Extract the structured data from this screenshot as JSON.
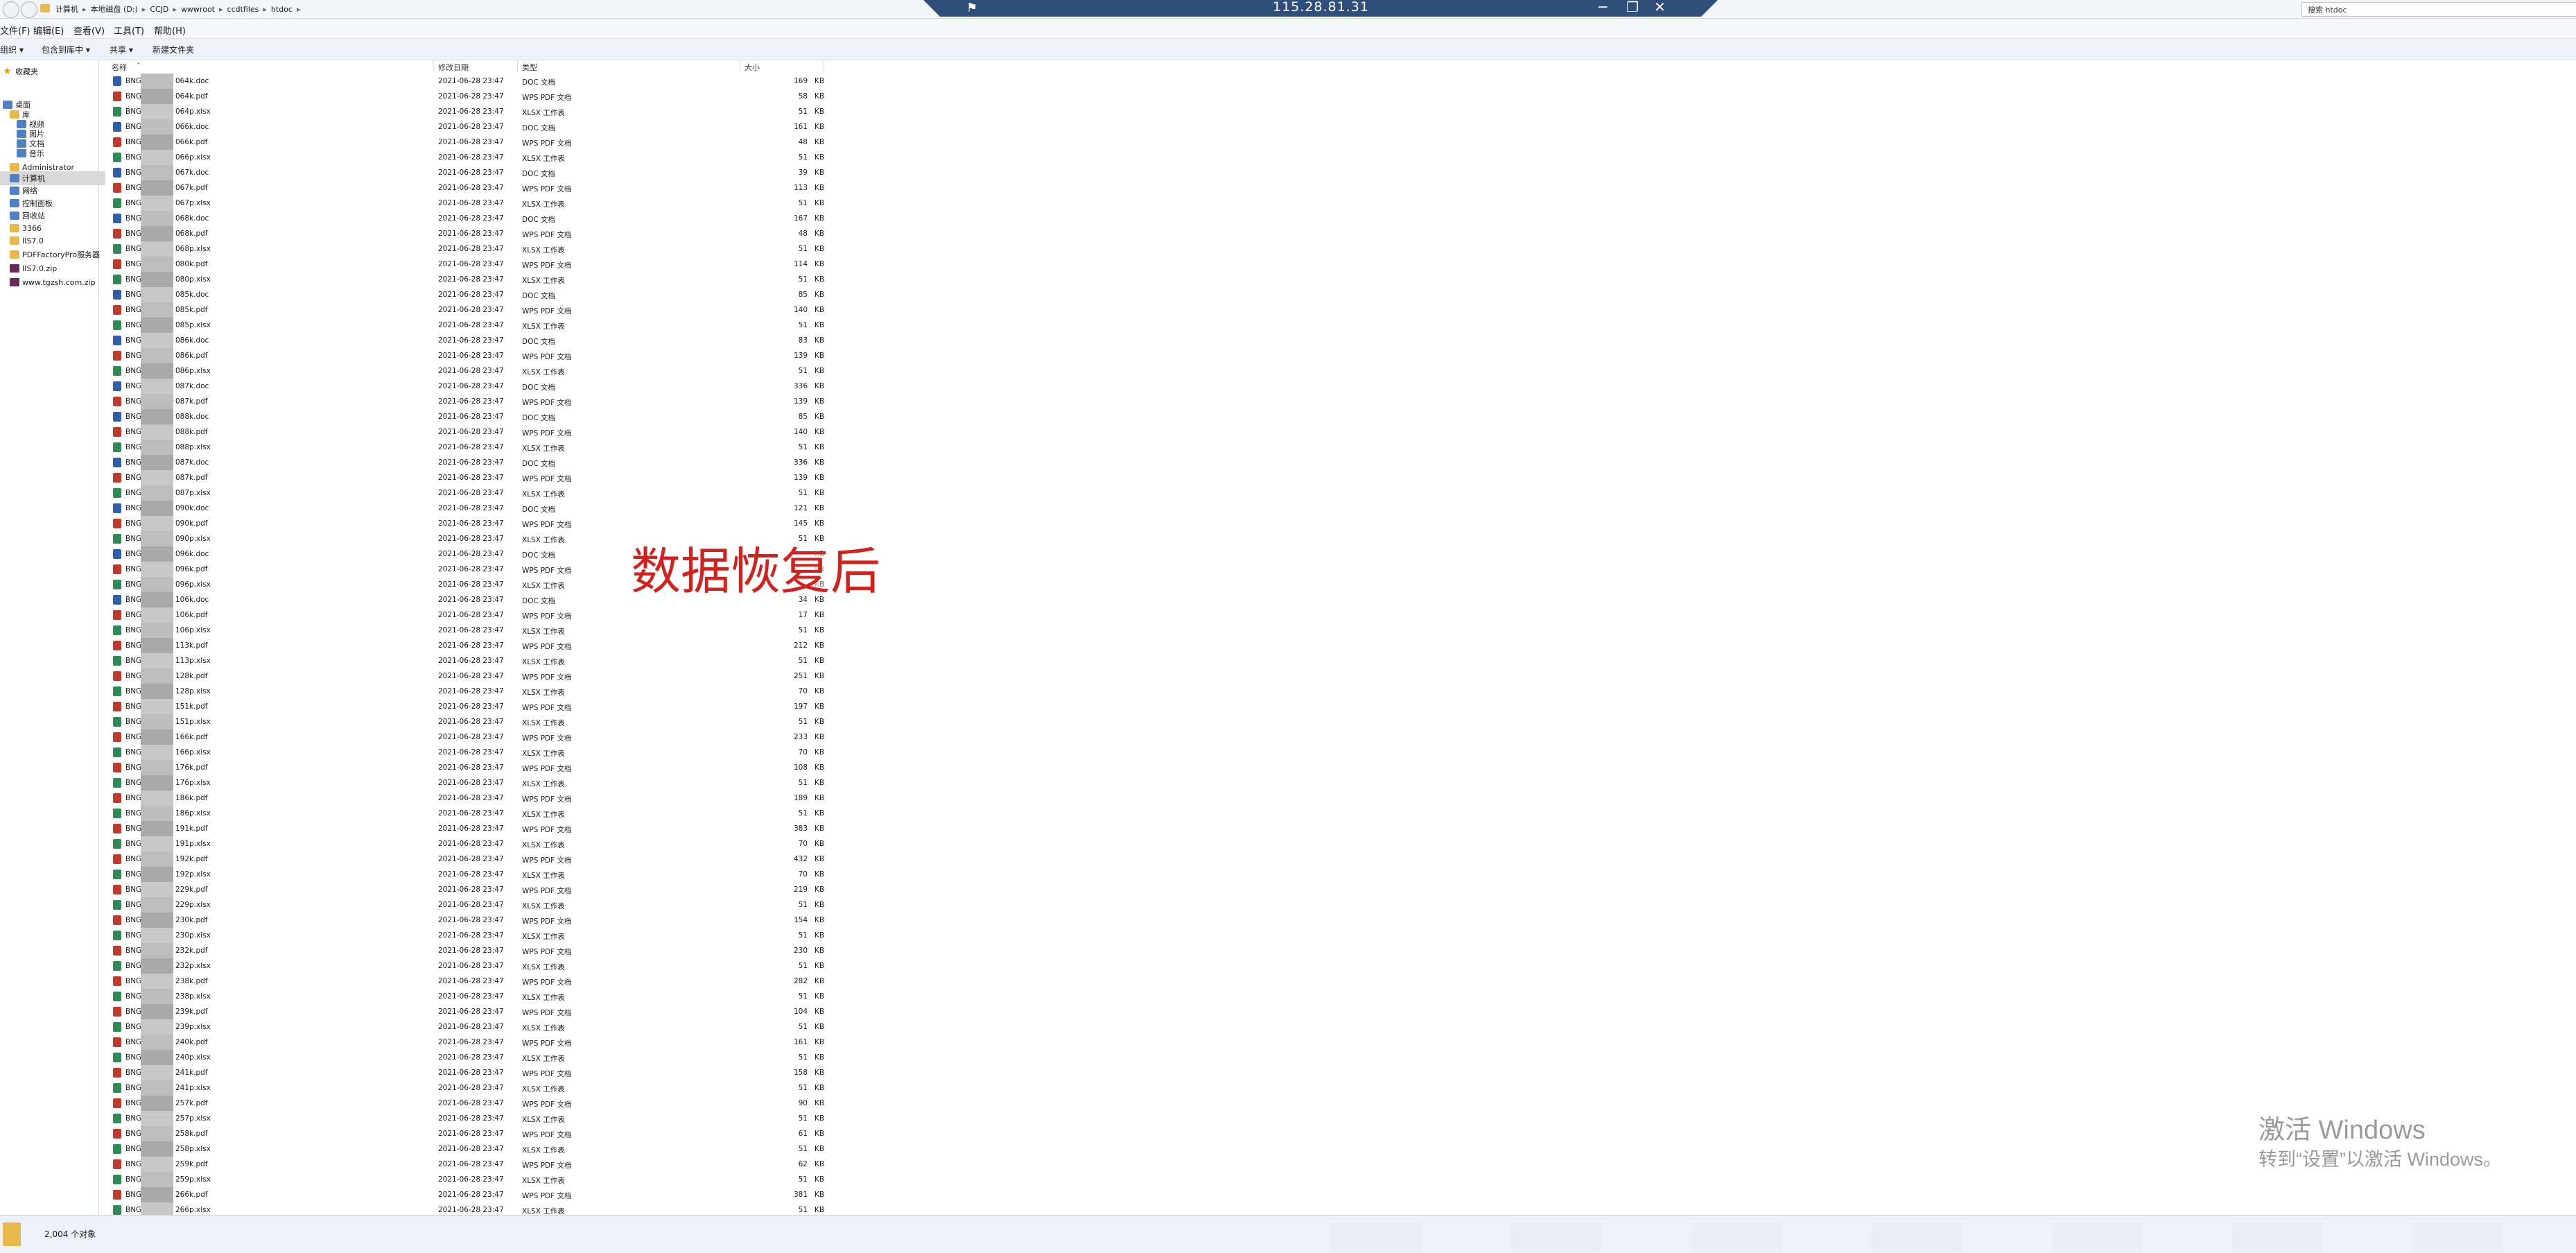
{
  "window": {
    "breadcrumb": [
      "计算机",
      "本地磁盘 (D:)",
      "CCJD",
      "wwwroot",
      "ccdtfiles",
      "htdoc"
    ],
    "remote_title": "115.28.81.31",
    "search_placeholder": "搜索 htdoc"
  },
  "menu": {
    "items": [
      "文件(F)",
      "编辑(E)",
      "查看(V)",
      "工具(T)",
      "帮助(H)"
    ]
  },
  "toolbar": {
    "items": [
      "组织 ▾",
      "包含到库中 ▾",
      "共享 ▾",
      "新建文件夹"
    ]
  },
  "nav": {
    "items": [
      {
        "label": "收藏夹",
        "icon": "star-icon",
        "level": 0
      },
      {
        "label": "桌面",
        "icon": "desktop-icon",
        "level": 0
      },
      {
        "label": "库",
        "icon": "library-icon",
        "level": 1
      },
      {
        "label": "视频",
        "icon": "video-icon",
        "level": 2
      },
      {
        "label": "图片",
        "icon": "picture-icon",
        "level": 2
      },
      {
        "label": "文档",
        "icon": "document-icon",
        "level": 2
      },
      {
        "label": "音乐",
        "icon": "music-icon",
        "level": 2
      },
      {
        "label": "Administrator",
        "icon": "user-folder-icon",
        "level": 1
      },
      {
        "label": "计算机",
        "icon": "computer-icon",
        "level": 1,
        "selected": true
      },
      {
        "label": "网络",
        "icon": "network-icon",
        "level": 1
      },
      {
        "label": "控制面板",
        "icon": "control-panel-icon",
        "level": 1
      },
      {
        "label": "回收站",
        "icon": "recycle-bin-icon",
        "level": 1
      },
      {
        "label": "3366",
        "icon": "folder-icon",
        "level": 1
      },
      {
        "label": "IIS7.0",
        "icon": "folder-icon",
        "level": 1
      },
      {
        "label": "PDFFactoryPro服务器",
        "icon": "folder-icon",
        "level": 1
      },
      {
        "label": "IIS7.0.zip",
        "icon": "zip-icon",
        "level": 1
      },
      {
        "label": "www.tgzsh.com.zip",
        "icon": "zip-icon",
        "level": 1
      }
    ]
  },
  "columns": [
    "名称",
    "修改日期",
    "类型",
    "大小"
  ],
  "file_prefix": "BNG",
  "date": "2021-06-28 23:47",
  "size_unit": "KB",
  "files": [
    {
      "n": "064k.doc",
      "t": "DOC 文档",
      "s": "169",
      "i": "doc"
    },
    {
      "n": "064k.pdf",
      "t": "WPS PDF 文档",
      "s": "58",
      "i": "pdf"
    },
    {
      "n": "064p.xlsx",
      "t": "XLSX 工作表",
      "s": "51",
      "i": "xls"
    },
    {
      "n": "066k.doc",
      "t": "DOC 文档",
      "s": "161",
      "i": "doc"
    },
    {
      "n": "066k.pdf",
      "t": "WPS PDF 文档",
      "s": "48",
      "i": "pdf"
    },
    {
      "n": "066p.xlsx",
      "t": "XLSX 工作表",
      "s": "51",
      "i": "xls"
    },
    {
      "n": "067k.doc",
      "t": "DOC 文档",
      "s": "39",
      "i": "doc"
    },
    {
      "n": "067k.pdf",
      "t": "WPS PDF 文档",
      "s": "113",
      "i": "pdf"
    },
    {
      "n": "067p.xlsx",
      "t": "XLSX 工作表",
      "s": "51",
      "i": "xls"
    },
    {
      "n": "068k.doc",
      "t": "DOC 文档",
      "s": "167",
      "i": "doc"
    },
    {
      "n": "068k.pdf",
      "t": "WPS PDF 文档",
      "s": "48",
      "i": "pdf"
    },
    {
      "n": "068p.xlsx",
      "t": "XLSX 工作表",
      "s": "51",
      "i": "xls"
    },
    {
      "n": "080k.pdf",
      "t": "WPS PDF 文档",
      "s": "114",
      "i": "pdf"
    },
    {
      "n": "080p.xlsx",
      "t": "XLSX 工作表",
      "s": "51",
      "i": "xls"
    },
    {
      "n": "085k.doc",
      "t": "DOC 文档",
      "s": "85",
      "i": "doc"
    },
    {
      "n": "085k.pdf",
      "t": "WPS PDF 文档",
      "s": "140",
      "i": "pdf"
    },
    {
      "n": "085p.xlsx",
      "t": "XLSX 工作表",
      "s": "51",
      "i": "xls"
    },
    {
      "n": "086k.doc",
      "t": "DOC 文档",
      "s": "83",
      "i": "doc"
    },
    {
      "n": "086k.pdf",
      "t": "WPS PDF 文档",
      "s": "139",
      "i": "pdf"
    },
    {
      "n": "086p.xlsx",
      "t": "XLSX 工作表",
      "s": "51",
      "i": "xls"
    },
    {
      "n": "087k.doc",
      "t": "DOC 文档",
      "s": "336",
      "i": "doc"
    },
    {
      "n": "087k.pdf",
      "t": "WPS PDF 文档",
      "s": "139",
      "i": "pdf"
    },
    {
      "n": "088k.doc",
      "t": "DOC 文档",
      "s": "85",
      "i": "doc"
    },
    {
      "n": "088k.pdf",
      "t": "WPS PDF 文档",
      "s": "140",
      "i": "pdf"
    },
    {
      "n": "088p.xlsx",
      "t": "XLSX 工作表",
      "s": "51",
      "i": "xls"
    },
    {
      "n": "087k.doc",
      "t": "DOC 文档",
      "s": "336",
      "i": "doc"
    },
    {
      "n": "087k.pdf",
      "t": "WPS PDF 文档",
      "s": "139",
      "i": "pdf"
    },
    {
      "n": "087p.xlsx",
      "t": "XLSX 工作表",
      "s": "51",
      "i": "xls"
    },
    {
      "n": "090k.doc",
      "t": "DOC 文档",
      "s": "121",
      "i": "doc"
    },
    {
      "n": "090k.pdf",
      "t": "WPS PDF 文档",
      "s": "145",
      "i": "pdf"
    },
    {
      "n": "090p.xlsx",
      "t": "XLSX 工作表",
      "s": "51",
      "i": "xls"
    },
    {
      "n": "096k.doc",
      "t": "DOC 文档",
      "s": "",
      "i": "doc"
    },
    {
      "n": "096k.pdf",
      "t": "WPS PDF 文档",
      "s": "",
      "i": "pdf"
    },
    {
      "n": "096p.xlsx",
      "t": "XLSX 工作表",
      "s": "",
      "i": "xls"
    },
    {
      "n": "106k.doc",
      "t": "DOC 文档",
      "s": "34",
      "i": "doc"
    },
    {
      "n": "106k.pdf",
      "t": "WPS PDF 文档",
      "s": "17",
      "i": "pdf"
    },
    {
      "n": "106p.xlsx",
      "t": "XLSX 工作表",
      "s": "51",
      "i": "xls"
    },
    {
      "n": "113k.pdf",
      "t": "WPS PDF 文档",
      "s": "212",
      "i": "pdf"
    },
    {
      "n": "113p.xlsx",
      "t": "XLSX 工作表",
      "s": "51",
      "i": "xls"
    },
    {
      "n": "128k.pdf",
      "t": "WPS PDF 文档",
      "s": "251",
      "i": "pdf"
    },
    {
      "n": "128p.xlsx",
      "t": "XLSX 工作表",
      "s": "70",
      "i": "xls"
    },
    {
      "n": "151k.pdf",
      "t": "WPS PDF 文档",
      "s": "197",
      "i": "pdf"
    },
    {
      "n": "151p.xlsx",
      "t": "XLSX 工作表",
      "s": "51",
      "i": "xls"
    },
    {
      "n": "166k.pdf",
      "t": "WPS PDF 文档",
      "s": "233",
      "i": "pdf"
    },
    {
      "n": "166p.xlsx",
      "t": "XLSX 工作表",
      "s": "70",
      "i": "xls"
    },
    {
      "n": "176k.pdf",
      "t": "WPS PDF 文档",
      "s": "108",
      "i": "pdf"
    },
    {
      "n": "176p.xlsx",
      "t": "XLSX 工作表",
      "s": "51",
      "i": "xls"
    },
    {
      "n": "186k.pdf",
      "t": "WPS PDF 文档",
      "s": "189",
      "i": "pdf"
    },
    {
      "n": "186p.xlsx",
      "t": "XLSX 工作表",
      "s": "51",
      "i": "xls"
    },
    {
      "n": "191k.pdf",
      "t": "WPS PDF 文档",
      "s": "383",
      "i": "pdf"
    },
    {
      "n": "191p.xlsx",
      "t": "XLSX 工作表",
      "s": "70",
      "i": "xls"
    },
    {
      "n": "192k.pdf",
      "t": "WPS PDF 文档",
      "s": "432",
      "i": "pdf"
    },
    {
      "n": "192p.xlsx",
      "t": "XLSX 工作表",
      "s": "70",
      "i": "xls"
    },
    {
      "n": "229k.pdf",
      "t": "WPS PDF 文档",
      "s": "219",
      "i": "pdf"
    },
    {
      "n": "229p.xlsx",
      "t": "XLSX 工作表",
      "s": "51",
      "i": "xls"
    },
    {
      "n": "230k.pdf",
      "t": "WPS PDF 文档",
      "s": "154",
      "i": "pdf"
    },
    {
      "n": "230p.xlsx",
      "t": "XLSX 工作表",
      "s": "51",
      "i": "xls"
    },
    {
      "n": "232k.pdf",
      "t": "WPS PDF 文档",
      "s": "230",
      "i": "pdf"
    },
    {
      "n": "232p.xlsx",
      "t": "XLSX 工作表",
      "s": "51",
      "i": "xls"
    },
    {
      "n": "238k.pdf",
      "t": "WPS PDF 文档",
      "s": "282",
      "i": "pdf"
    },
    {
      "n": "238p.xlsx",
      "t": "XLSX 工作表",
      "s": "51",
      "i": "xls"
    },
    {
      "n": "239k.pdf",
      "t": "WPS PDF 文档",
      "s": "104",
      "i": "pdf"
    },
    {
      "n": "239p.xlsx",
      "t": "XLSX 工作表",
      "s": "51",
      "i": "xls"
    },
    {
      "n": "240k.pdf",
      "t": "WPS PDF 文档",
      "s": "161",
      "i": "pdf"
    },
    {
      "n": "240p.xlsx",
      "t": "XLSX 工作表",
      "s": "51",
      "i": "xls"
    },
    {
      "n": "241k.pdf",
      "t": "WPS PDF 文档",
      "s": "158",
      "i": "pdf"
    },
    {
      "n": "241p.xlsx",
      "t": "XLSX 工作表",
      "s": "51",
      "i": "xls"
    },
    {
      "n": "257k.pdf",
      "t": "WPS PDF 文档",
      "s": "90",
      "i": "pdf"
    },
    {
      "n": "257p.xlsx",
      "t": "XLSX 工作表",
      "s": "51",
      "i": "xls"
    },
    {
      "n": "258k.pdf",
      "t": "WPS PDF 文档",
      "s": "61",
      "i": "pdf"
    },
    {
      "n": "258p.xlsx",
      "t": "XLSX 工作表",
      "s": "51",
      "i": "xls"
    },
    {
      "n": "259k.pdf",
      "t": "WPS PDF 文档",
      "s": "62",
      "i": "pdf"
    },
    {
      "n": "259p.xlsx",
      "t": "XLSX 工作表",
      "s": "51",
      "i": "xls"
    },
    {
      "n": "266k.pdf",
      "t": "WPS PDF 文档",
      "s": "381",
      "i": "pdf"
    },
    {
      "n": "266p.xlsx",
      "t": "XLSX 工作表",
      "s": "51",
      "i": "xls"
    }
  ],
  "overlay_label": "数据恢复后",
  "watermark": {
    "title": "激活 Windows",
    "subtitle": "转到“设置”以激活 Windows。"
  },
  "status": {
    "count": "2,004 个对象"
  },
  "colors": {
    "rdp_bar": "#2f4e79",
    "overlay_text": "#d3221e",
    "pdf_icon": "#c0392b",
    "xls_icon": "#2e8b57",
    "doc_icon": "#2f5ea8",
    "folder": "#e7b84a"
  }
}
